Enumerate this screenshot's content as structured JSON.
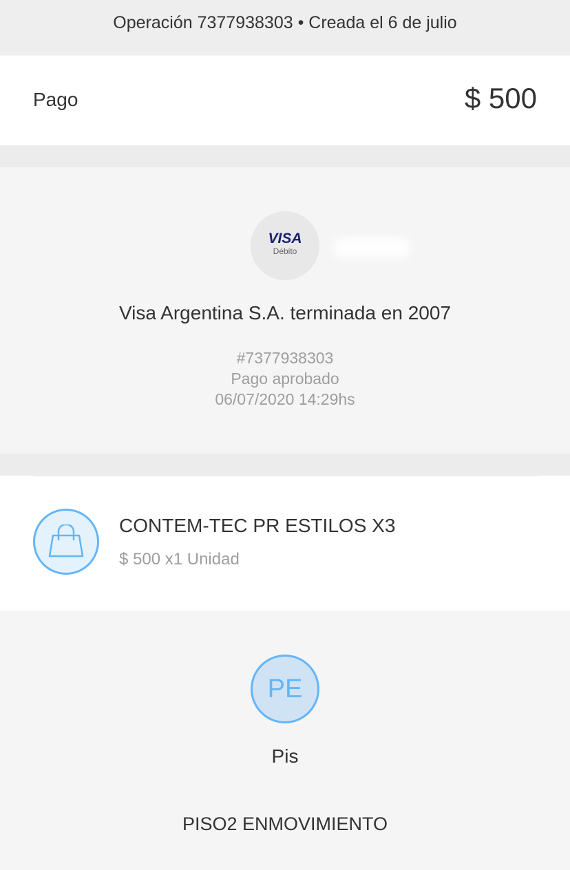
{
  "header": {
    "operation_text": "Operación 7377938303 • Creada el 6 de julio"
  },
  "payment": {
    "label": "Pago",
    "amount": "$ 500"
  },
  "card": {
    "brand": "VISA",
    "type": "Débito",
    "name": "Visa Argentina S.A. terminada en 2007",
    "reference": "#7377938303",
    "status": "Pago aprobado",
    "datetime": "06/07/2020 14:29hs"
  },
  "item": {
    "icon": "shopping-bag-icon",
    "title": "CONTEM-TEC PR ESTILOS X3",
    "subtitle": "$ 500 x1 Unidad"
  },
  "seller": {
    "initials": "PE",
    "name": "Pis",
    "store": "PISO2 ENMOVIMIENTO"
  },
  "colors": {
    "accent": "#64b5f6",
    "visa_blue": "#1a1f71",
    "muted_text": "#9e9e9e"
  }
}
